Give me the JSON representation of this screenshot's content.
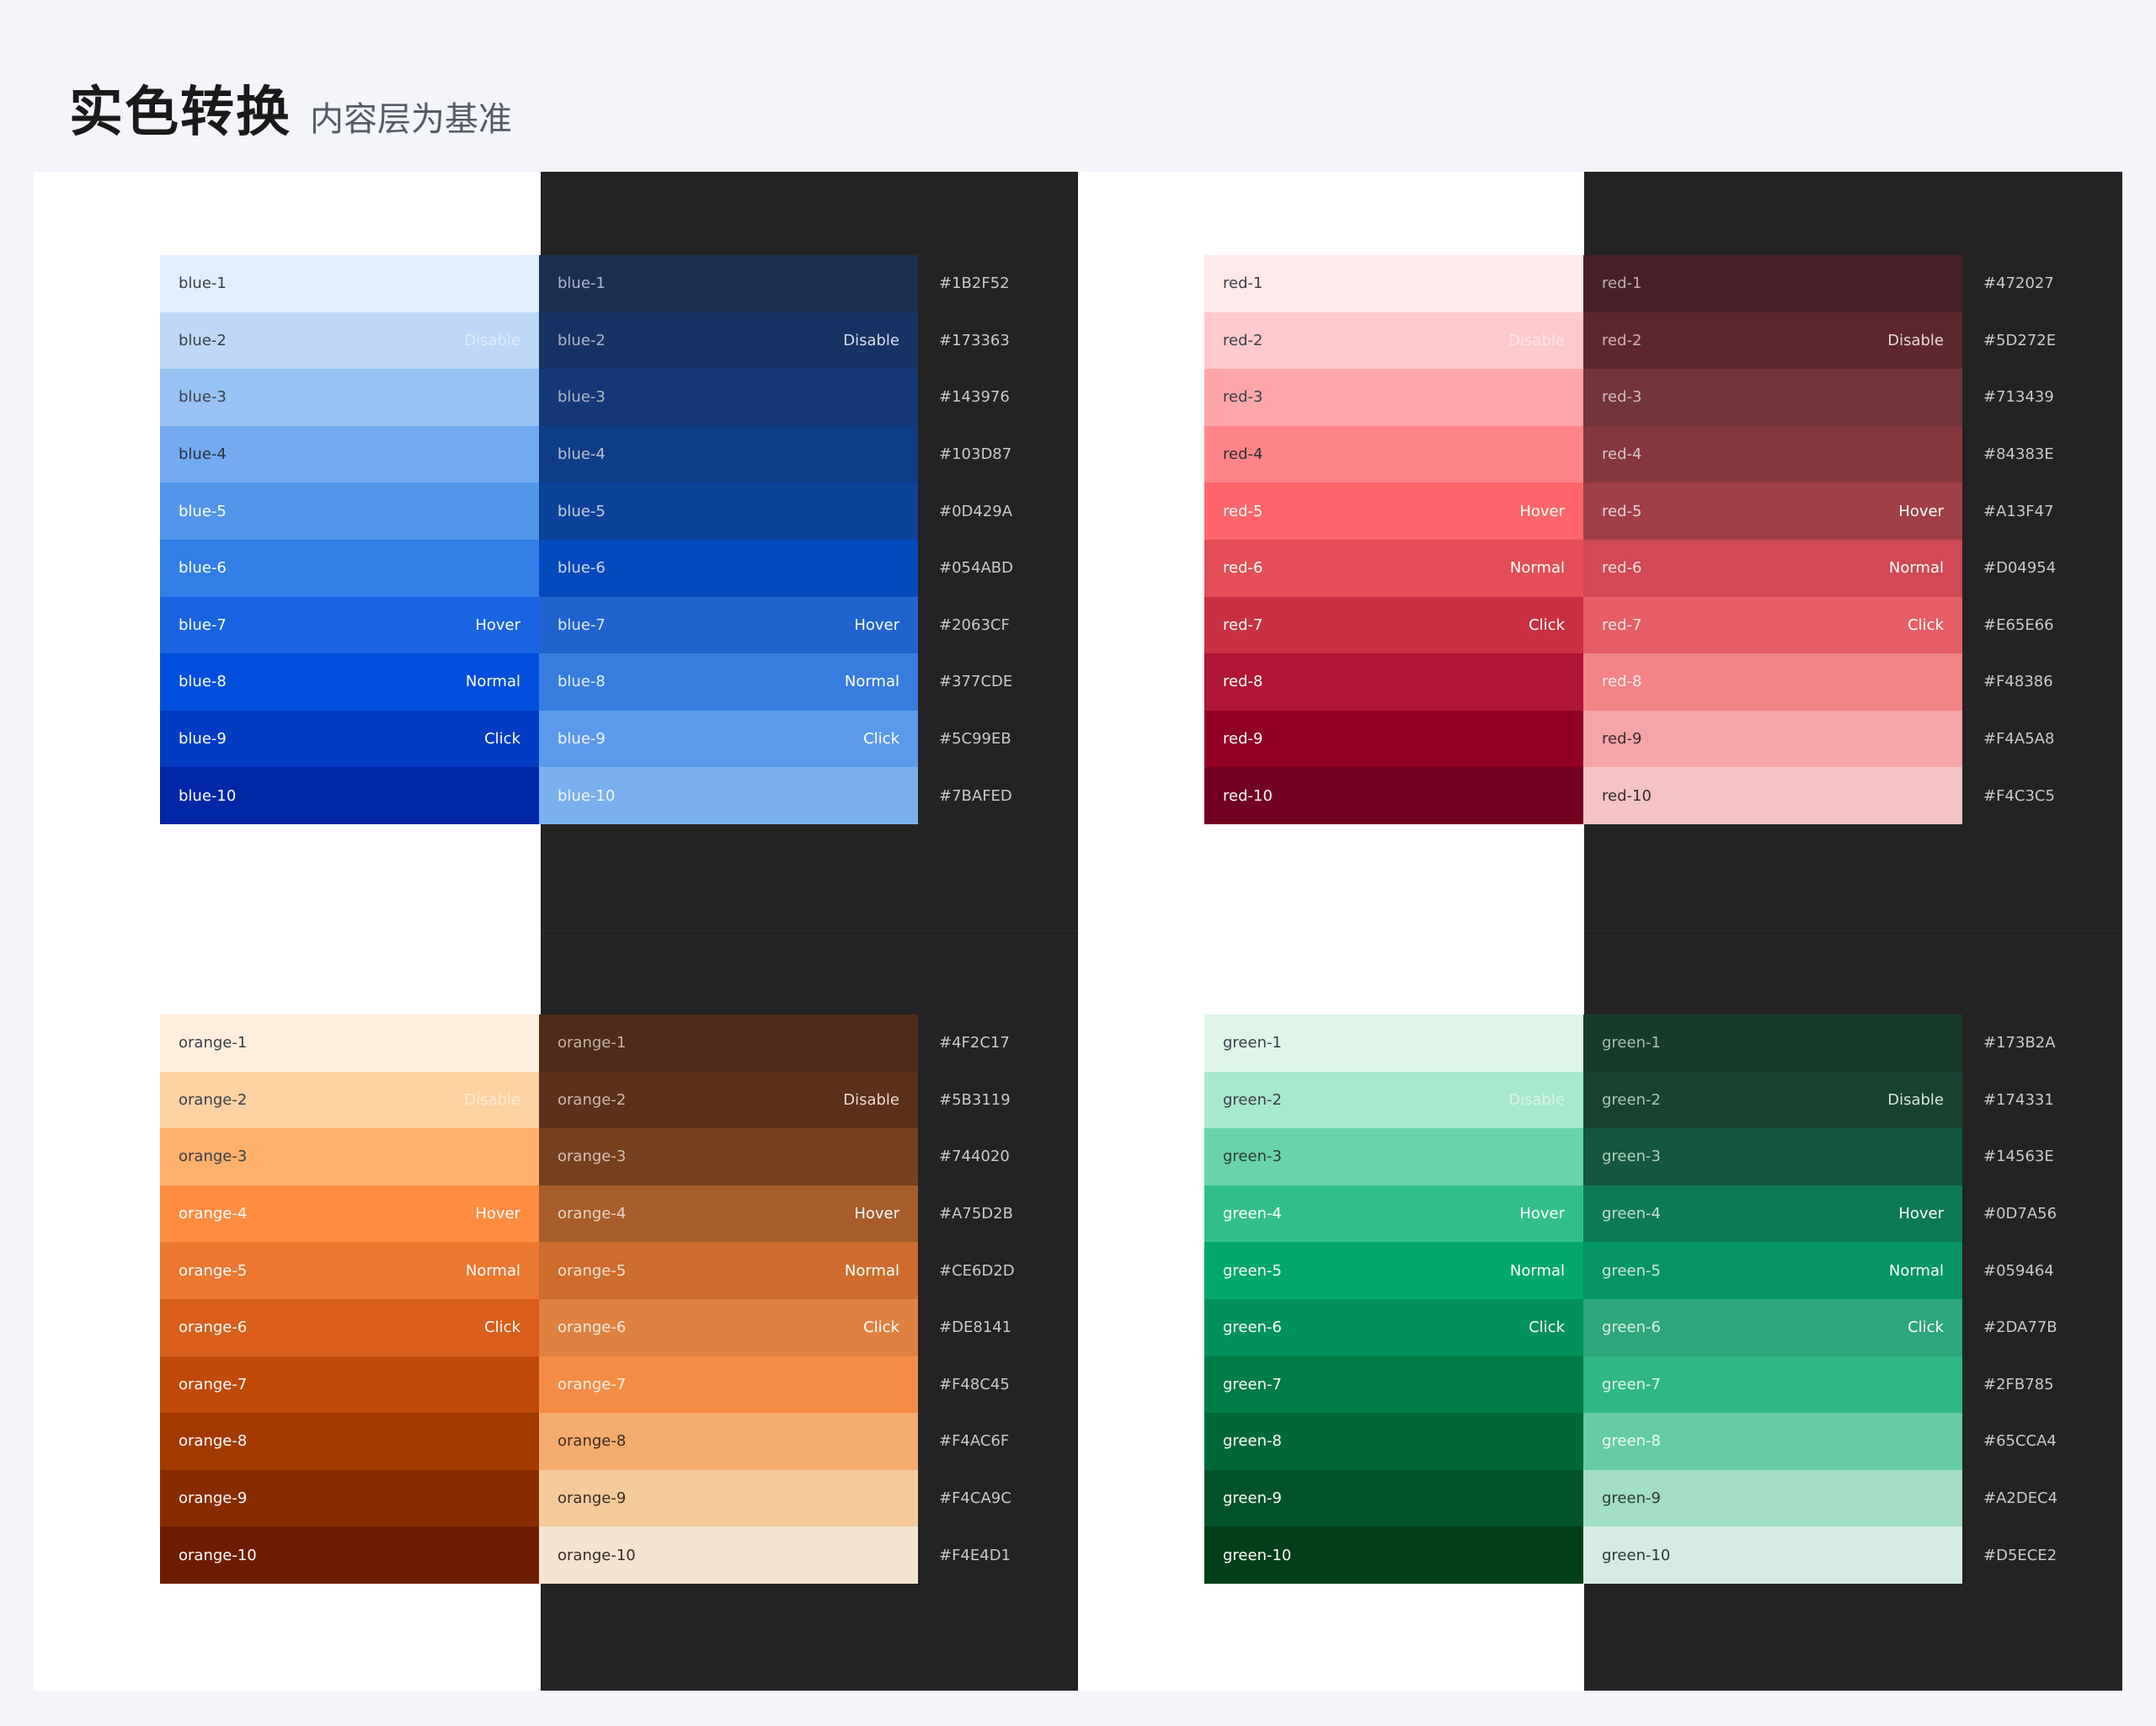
{
  "header": {
    "title": "实色转换",
    "subtitle": "内容层为基准"
  },
  "palettes": [
    {
      "name": "blue",
      "light": [
        {
          "label": "blue-1",
          "state": "",
          "bg": "#E1EEFD",
          "fg": "#3A3F48",
          "sfg": ""
        },
        {
          "label": "blue-2",
          "state": "Disable",
          "bg": "#BDD8F8",
          "fg": "#3A3F48",
          "sfg": "#DCEBFB"
        },
        {
          "label": "blue-3",
          "state": "",
          "bg": "#98C3F4",
          "fg": "#3A3F48",
          "sfg": ""
        },
        {
          "label": "blue-4",
          "state": "",
          "bg": "#74AAEF",
          "fg": "#2A3142",
          "sfg": ""
        },
        {
          "label": "blue-5",
          "state": "",
          "bg": "#5196EA",
          "fg": "#FFFFFF",
          "sfg": ""
        },
        {
          "label": "blue-6",
          "state": "",
          "bg": "#307EE6",
          "fg": "#FFFFFF",
          "sfg": ""
        },
        {
          "label": "blue-7",
          "state": "Hover",
          "bg": "#1A64E2",
          "fg": "#FFFFFF",
          "sfg": "#FFFFFF"
        },
        {
          "label": "blue-8",
          "state": "Normal",
          "bg": "#004FDC",
          "fg": "#FFFFFF",
          "sfg": "#FFFFFF"
        },
        {
          "label": "blue-9",
          "state": "Click",
          "bg": "#023CC3",
          "fg": "#FFFFFF",
          "sfg": "#FFFFFF"
        },
        {
          "label": "blue-10",
          "state": "",
          "bg": "#0126A7",
          "fg": "#FFFFFF",
          "sfg": ""
        }
      ],
      "dark": [
        {
          "label": "blue-1",
          "state": "",
          "bg": "#1B2F52",
          "fg": "#AEB6C4",
          "sfg": ""
        },
        {
          "label": "blue-2",
          "state": "Disable",
          "bg": "#173363",
          "fg": "#AEB6C4",
          "sfg": "#D8DEE8"
        },
        {
          "label": "blue-3",
          "state": "",
          "bg": "#143976",
          "fg": "#AEB6C4",
          "sfg": ""
        },
        {
          "label": "blue-4",
          "state": "",
          "bg": "#103D87",
          "fg": "#B8C1D0",
          "sfg": ""
        },
        {
          "label": "blue-5",
          "state": "",
          "bg": "#0D429A",
          "fg": "#C6CEDB",
          "sfg": ""
        },
        {
          "label": "blue-6",
          "state": "",
          "bg": "#054ABD",
          "fg": "#D2D9E6",
          "sfg": ""
        },
        {
          "label": "blue-7",
          "state": "Hover",
          "bg": "#2063CF",
          "fg": "#E2E8F2",
          "sfg": "#FFFFFF"
        },
        {
          "label": "blue-8",
          "state": "Normal",
          "bg": "#377CDE",
          "fg": "#E8EEF8",
          "sfg": "#FFFFFF"
        },
        {
          "label": "blue-9",
          "state": "Click",
          "bg": "#5C99EB",
          "fg": "#EEF3FB",
          "sfg": "#FFFFFF"
        },
        {
          "label": "blue-10",
          "state": "",
          "bg": "#7BAFED",
          "fg": "#F2F6FC",
          "sfg": ""
        }
      ],
      "hex": [
        "#1B2F52",
        "#173363",
        "#143976",
        "#103D87",
        "#0D429A",
        "#054ABD",
        "#2063CF",
        "#377CDE",
        "#5C99EB",
        "#7BAFED"
      ]
    },
    {
      "name": "red",
      "light": [
        {
          "label": "red-1",
          "state": "",
          "bg": "#FFE8E9",
          "fg": "#3A3F48",
          "sfg": ""
        },
        {
          "label": "red-2",
          "state": "Disable",
          "bg": "#FFC9CD",
          "fg": "#3A3F48",
          "sfg": "#FFE4E6"
        },
        {
          "label": "red-3",
          "state": "",
          "bg": "#FFA6AB",
          "fg": "#3A3F48",
          "sfg": ""
        },
        {
          "label": "red-4",
          "state": "",
          "bg": "#FF8488",
          "fg": "#2E2E2E",
          "sfg": ""
        },
        {
          "label": "red-5",
          "state": "Hover",
          "bg": "#FF656A",
          "fg": "#FFFFFF",
          "sfg": "#FFFFFF"
        },
        {
          "label": "red-6",
          "state": "Normal",
          "bg": "#E34E56",
          "fg": "#FFFFFF",
          "sfg": "#FFFFFF"
        },
        {
          "label": "red-7",
          "state": "Click",
          "bg": "#C93142",
          "fg": "#FFFFFF",
          "sfg": "#FFFFFF"
        },
        {
          "label": "red-8",
          "state": "",
          "bg": "#AE1633",
          "fg": "#FFFFFF",
          "sfg": ""
        },
        {
          "label": "red-9",
          "state": "",
          "bg": "#920023",
          "fg": "#FFFFFF",
          "sfg": ""
        },
        {
          "label": "red-10",
          "state": "",
          "bg": "#720020",
          "fg": "#FFFFFF",
          "sfg": ""
        }
      ],
      "dark": [
        {
          "label": "red-1",
          "state": "",
          "bg": "#472027",
          "fg": "#C0AEB1",
          "sfg": ""
        },
        {
          "label": "red-2",
          "state": "Disable",
          "bg": "#5D272E",
          "fg": "#C9B5B8",
          "sfg": "#E6D9DB"
        },
        {
          "label": "red-3",
          "state": "",
          "bg": "#713439",
          "fg": "#D0BDBF",
          "sfg": ""
        },
        {
          "label": "red-4",
          "state": "",
          "bg": "#84383E",
          "fg": "#D8C6C8",
          "sfg": ""
        },
        {
          "label": "red-5",
          "state": "Hover",
          "bg": "#A13F47",
          "fg": "#E4D3D5",
          "sfg": "#FFFFFF"
        },
        {
          "label": "red-6",
          "state": "Normal",
          "bg": "#D04954",
          "fg": "#F0E0E2",
          "sfg": "#FFFFFF"
        },
        {
          "label": "red-7",
          "state": "Click",
          "bg": "#E65E66",
          "fg": "#F6E6E7",
          "sfg": "#FFFFFF"
        },
        {
          "label": "red-8",
          "state": "",
          "bg": "#F48386",
          "fg": "#FBEEEF",
          "sfg": ""
        },
        {
          "label": "red-9",
          "state": "",
          "bg": "#F4A5A8",
          "fg": "#3A2A2C",
          "sfg": ""
        },
        {
          "label": "red-10",
          "state": "",
          "bg": "#F4C3C5",
          "fg": "#3A2A2C",
          "sfg": ""
        }
      ],
      "hex": [
        "#472027",
        "#5D272E",
        "#713439",
        "#84383E",
        "#A13F47",
        "#D04954",
        "#E65E66",
        "#F48386",
        "#F4A5A8",
        "#F4C3C5"
      ]
    },
    {
      "name": "orange",
      "light": [
        {
          "label": "orange-1",
          "state": "",
          "bg": "#FFEEDC",
          "fg": "#3A3F48",
          "sfg": ""
        },
        {
          "label": "orange-2",
          "state": "Disable",
          "bg": "#FFD2A2",
          "fg": "#3A3F48",
          "sfg": "#FFE9D2"
        },
        {
          "label": "orange-3",
          "state": "",
          "bg": "#FFB06C",
          "fg": "#3A3F48",
          "sfg": ""
        },
        {
          "label": "orange-4",
          "state": "Hover",
          "bg": "#FF8D41",
          "fg": "#FFFFFF",
          "sfg": "#FFFFFF"
        },
        {
          "label": "orange-5",
          "state": "Normal",
          "bg": "#EC7830",
          "fg": "#FFFFFF",
          "sfg": "#FFFFFF"
        },
        {
          "label": "orange-6",
          "state": "Click",
          "bg": "#D95E1C",
          "fg": "#FFFFFF",
          "sfg": "#FFFFFF"
        },
        {
          "label": "orange-7",
          "state": "",
          "bg": "#C14A08",
          "fg": "#FFFFFF",
          "sfg": ""
        },
        {
          "label": "orange-8",
          "state": "",
          "bg": "#A33A00",
          "fg": "#FFFFFF",
          "sfg": ""
        },
        {
          "label": "orange-9",
          "state": "",
          "bg": "#882C00",
          "fg": "#FFFFFF",
          "sfg": ""
        },
        {
          "label": "orange-10",
          "state": "",
          "bg": "#6E1E00",
          "fg": "#FFFFFF",
          "sfg": ""
        }
      ],
      "dark": [
        {
          "label": "orange-1",
          "state": "",
          "bg": "#4F2C17",
          "fg": "#C4B3A8",
          "sfg": ""
        },
        {
          "label": "orange-2",
          "state": "Disable",
          "bg": "#5B3119",
          "fg": "#CBB9AD",
          "sfg": "#E7DAD2"
        },
        {
          "label": "orange-3",
          "state": "",
          "bg": "#744020",
          "fg": "#D4C2B5",
          "sfg": ""
        },
        {
          "label": "orange-4",
          "state": "Hover",
          "bg": "#A75D2B",
          "fg": "#E6D6CB",
          "sfg": "#FFFFFF"
        },
        {
          "label": "orange-5",
          "state": "Normal",
          "bg": "#CE6D2D",
          "fg": "#F2E3D8",
          "sfg": "#FFFFFF"
        },
        {
          "label": "orange-6",
          "state": "Click",
          "bg": "#DE8141",
          "fg": "#F6E8DE",
          "sfg": "#FFFFFF"
        },
        {
          "label": "orange-7",
          "state": "",
          "bg": "#F48C45",
          "fg": "#FBEFE6",
          "sfg": ""
        },
        {
          "label": "orange-8",
          "state": "",
          "bg": "#F4AC6F",
          "fg": "#3A2C22",
          "sfg": ""
        },
        {
          "label": "orange-9",
          "state": "",
          "bg": "#F4CA9C",
          "fg": "#3A2C22",
          "sfg": ""
        },
        {
          "label": "orange-10",
          "state": "",
          "bg": "#F4E4D1",
          "fg": "#3A2C22",
          "sfg": ""
        }
      ],
      "hex": [
        "#4F2C17",
        "#5B3119",
        "#744020",
        "#A75D2B",
        "#CE6D2D",
        "#DE8141",
        "#F48C45",
        "#F4AC6F",
        "#F4CA9C",
        "#F4E4D1"
      ]
    },
    {
      "name": "green",
      "light": [
        {
          "label": "green-1",
          "state": "",
          "bg": "#DEF6EA",
          "fg": "#3A3F48",
          "sfg": ""
        },
        {
          "label": "green-2",
          "state": "Disable",
          "bg": "#A8E8CC",
          "fg": "#3A3F48",
          "sfg": "#D6F3E6"
        },
        {
          "label": "green-3",
          "state": "",
          "bg": "#69D4A9",
          "fg": "#2E3A34",
          "sfg": ""
        },
        {
          "label": "green-4",
          "state": "Hover",
          "bg": "#32C08A",
          "fg": "#FFFFFF",
          "sfg": "#FFFFFF"
        },
        {
          "label": "green-5",
          "state": "Normal",
          "bg": "#00A86B",
          "fg": "#FFFFFF",
          "sfg": "#FFFFFF"
        },
        {
          "label": "green-6",
          "state": "Click",
          "bg": "#00925A",
          "fg": "#FFFFFF",
          "sfg": "#FFFFFF"
        },
        {
          "label": "green-7",
          "state": "",
          "bg": "#007C47",
          "fg": "#FFFFFF",
          "sfg": ""
        },
        {
          "label": "green-8",
          "state": "",
          "bg": "#006837",
          "fg": "#FFFFFF",
          "sfg": ""
        },
        {
          "label": "green-9",
          "state": "",
          "bg": "#005428",
          "fg": "#FFFFFF",
          "sfg": ""
        },
        {
          "label": "green-10",
          "state": "",
          "bg": "#003F17",
          "fg": "#FFFFFF",
          "sfg": ""
        }
      ],
      "dark": [
        {
          "label": "green-1",
          "state": "",
          "bg": "#173B2A",
          "fg": "#A9BDB3",
          "sfg": ""
        },
        {
          "label": "green-2",
          "state": "Disable",
          "bg": "#174331",
          "fg": "#B0C4BA",
          "sfg": "#D8E4DE"
        },
        {
          "label": "green-3",
          "state": "",
          "bg": "#14563E",
          "fg": "#B7CCC1",
          "sfg": ""
        },
        {
          "label": "green-4",
          "state": "Hover",
          "bg": "#0D7A56",
          "fg": "#C6DBD0",
          "sfg": "#FFFFFF"
        },
        {
          "label": "green-5",
          "state": "Normal",
          "bg": "#059464",
          "fg": "#D2E6DB",
          "sfg": "#FFFFFF"
        },
        {
          "label": "green-6",
          "state": "Click",
          "bg": "#2DA77B",
          "fg": "#DEEEE6",
          "sfg": "#FFFFFF"
        },
        {
          "label": "green-7",
          "state": "",
          "bg": "#2FB785",
          "fg": "#E6F4ED",
          "sfg": ""
        },
        {
          "label": "green-8",
          "state": "",
          "bg": "#65CCA4",
          "fg": "#F0FAF5",
          "sfg": ""
        },
        {
          "label": "green-9",
          "state": "",
          "bg": "#A2DEC4",
          "fg": "#2A3A32",
          "sfg": ""
        },
        {
          "label": "green-10",
          "state": "",
          "bg": "#D5ECE2",
          "fg": "#2A3A32",
          "sfg": ""
        }
      ],
      "hex": [
        "#173B2A",
        "#174331",
        "#14563E",
        "#0D7A56",
        "#059464",
        "#2DA77B",
        "#2FB785",
        "#65CCA4",
        "#A2DEC4",
        "#D5ECE2"
      ]
    }
  ]
}
